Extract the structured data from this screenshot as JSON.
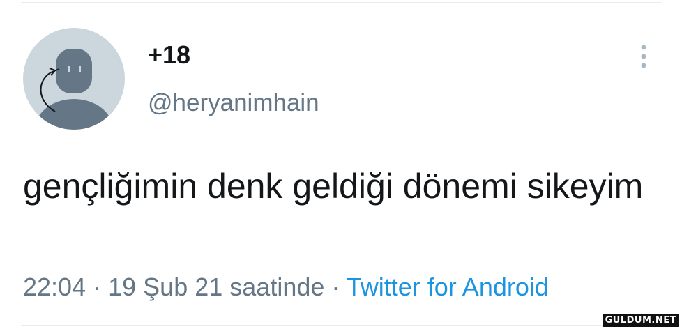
{
  "tweet": {
    "author": {
      "display_name": "+18",
      "handle": "@heryanimhain",
      "avatar_icon": "default-avatar-icon"
    },
    "text": "gençliğimin denk geldiği dönemi sikeyim",
    "time": "22:04",
    "date": "19 Şub 21 saatinde",
    "separator": "·",
    "source": "Twitter for Android",
    "more_icon": "more-vertical-icon"
  },
  "watermark": {
    "text": "GULDUM.NET"
  },
  "colors": {
    "text_primary": "#14171a",
    "text_secondary": "#657786",
    "link": "#1b95e0",
    "avatar_bg": "#ccd6dd",
    "avatar_figure": "#657786"
  }
}
